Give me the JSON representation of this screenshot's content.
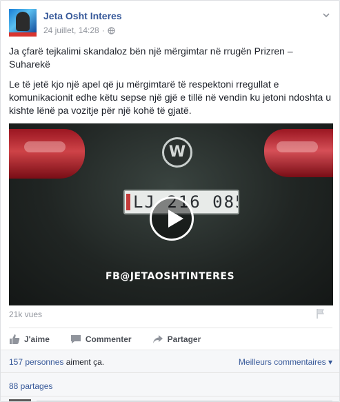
{
  "post": {
    "page_name": "Jeta Osht Interes",
    "timestamp": "24 juillet, 14:28",
    "separator": "·",
    "paragraph_1": "Ja çfarë tejkalimi skandaloz bën një mërgimtar në rrugën Prizren – Suharekë",
    "paragraph_2": "Le të jetë kjo një apel që ju mërgimtarë të respektoni rregullat e komunikacionit edhe këtu sepse një gjë e tillë në vendin ku jetoni ndoshta u kishte lënë pa vozitje për një kohë të gjatë."
  },
  "video": {
    "plate_text": "LJ 216 085",
    "watermark": "FB@JETAOSHTINTERES",
    "views": "21k vues"
  },
  "actions": {
    "like": "J'aime",
    "comment": "Commenter",
    "share": "Partager"
  },
  "summary": {
    "likes_link": "157 personnes",
    "likes_rest": " aiment ça.",
    "best_comments": "Meilleurs commentaires",
    "shares": "88 partages"
  },
  "colors": {
    "link": "#365899",
    "meta": "#90949c",
    "text": "#1d2129"
  },
  "icons": [
    "globe-icon",
    "chevron-down-icon",
    "play-icon",
    "flag-icon",
    "like-icon",
    "comment-icon",
    "share-icon"
  ]
}
